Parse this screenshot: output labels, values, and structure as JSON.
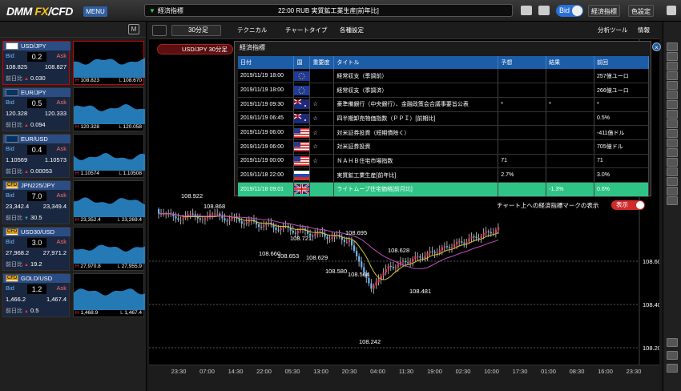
{
  "header": {
    "logo": "DMM FX/CFD",
    "menu_label": "MENU",
    "ticker_label": "経済指標",
    "ticker_message": "22:00 RUB 実質鉱工業生産[前年比]",
    "bid_toggle": "Bid",
    "eco_indicator_btn": "経済指標",
    "color_setting_btn": "色設定"
  },
  "rates": [
    {
      "name": "USD/JPY",
      "bid_label": "Bid",
      "ask_label": "Ask",
      "spread": "0.2",
      "bid": "108.825",
      "ask": "108.827",
      "prev_label": "前日比",
      "change": "0.030",
      "dir": "up",
      "high": "108.823",
      "low": "108.670"
    },
    {
      "name": "EUR/JPY",
      "bid_label": "Bid",
      "ask_label": "Ask",
      "spread": "0.5",
      "bid": "120.328",
      "ask": "120.333",
      "prev_label": "前日比",
      "change": "0.094",
      "dir": "up",
      "high": "120.328",
      "low": "120.058"
    },
    {
      "name": "EUR/USD",
      "bid_label": "Bid",
      "ask_label": "Ask",
      "spread": "0.4",
      "bid": "1.10569",
      "ask": "1.10573",
      "prev_label": "前日比",
      "change": "0.00053",
      "dir": "up",
      "high": "1.10574",
      "low": "1.10508"
    },
    {
      "name": "JPN225/JPY",
      "bid_label": "Bid",
      "ask_label": "Ask",
      "spread": "7.0",
      "bid": "23,342.4",
      "ask": "23,349.4",
      "prev_label": "前日比",
      "change": "30.5",
      "dir": "dn",
      "high": "23,352.4",
      "low": "23,269.4"
    },
    {
      "name": "USD30/USD",
      "bid_label": "Bid",
      "ask_label": "Ask",
      "spread": "3.0",
      "bid": "27,968.2",
      "ask": "27,971.2",
      "prev_label": "前日比",
      "change": "19.2",
      "dir": "up",
      "high": "27,970.8",
      "low": "27,955.9"
    },
    {
      "name": "GOLD/USD",
      "bid_label": "Bid",
      "ask_label": "Ask",
      "spread": "1.2",
      "bid": "1,466.2",
      "ask": "1,467.4",
      "prev_label": "前日比",
      "change": "0.5",
      "dir": "up",
      "high": "1,468.9",
      "low": "1,467.4"
    }
  ],
  "chart": {
    "period": "30分足",
    "technical_btn": "テクニカル",
    "chart_type_btn": "チャートタイプ",
    "settings_btn": "各種設定",
    "analysis_btn": "分析ツール",
    "info_btn": "情報",
    "tab_label": "USD/JPY 30分足",
    "y_labels": [
      "108.600",
      "108.400",
      "108.200"
    ],
    "time_labels": [
      "23:30",
      "07:00",
      "14:30",
      "22:00",
      "05:30",
      "13:00",
      "20:30",
      "04:00",
      "11:30",
      "19:00",
      "02:30",
      "10:00",
      "17:30",
      "01:00",
      "08:30",
      "16:00",
      "23:30"
    ],
    "price_labels": [
      "108.922",
      "108.868",
      "108.721",
      "108.695",
      "108.660",
      "108.653",
      "108.629",
      "108.628",
      "108.580",
      "108.564",
      "108.481",
      "108.242"
    ],
    "mark_toggle_label": "チャート上への経済指標マークの表示",
    "mark_btn": "表示"
  },
  "eco_panel": {
    "title": "経済指標",
    "headers": [
      "日付",
      "国",
      "重要度",
      "タイトル",
      "予想",
      "結果",
      "前回"
    ],
    "rows": [
      {
        "date": "2019/11/19 18:00",
        "flag": "eu",
        "importance": "",
        "title": "経常収支（季調前）",
        "forecast": "",
        "result": "",
        "previous": "257億ユーロ"
      },
      {
        "date": "2019/11/19 18:00",
        "flag": "eu",
        "importance": "",
        "title": "経常収支（季調済）",
        "forecast": "",
        "result": "",
        "previous": "266億ユーロ"
      },
      {
        "date": "2019/11/19 09:30",
        "flag": "au",
        "importance": "☆",
        "title": "豪準備銀行（中央銀行）、金融政策会合議事要旨公表",
        "forecast": "*",
        "result": "*",
        "previous": "*"
      },
      {
        "date": "2019/11/19 06:45",
        "flag": "au",
        "importance": "☆",
        "title": "四半期卸売物価指数（ＰＰＩ）[前期比]",
        "forecast": "",
        "result": "",
        "previous": "0.5%"
      },
      {
        "date": "2019/11/19 06:00",
        "flag": "us",
        "importance": "☆",
        "title": "対米証券投資（短期債除く）",
        "forecast": "",
        "result": "",
        "previous": "-411億ドル"
      },
      {
        "date": "2019/11/19 06:00",
        "flag": "us",
        "importance": "☆",
        "title": "対米証券投資",
        "forecast": "",
        "result": "",
        "previous": "705億ドル"
      },
      {
        "date": "2019/11/19 00:00",
        "flag": "us",
        "importance": "☆",
        "title": "ＮＡＨＢ住宅市場指数",
        "forecast": "71",
        "result": "",
        "previous": "71"
      },
      {
        "date": "2019/11/18 22:00",
        "flag": "ru",
        "importance": "",
        "title": "実質鉱工業生産[前年比]",
        "forecast": "2.7%",
        "result": "",
        "previous": "3.0%"
      },
      {
        "date": "2019/11/18 09:01",
        "flag": "uk",
        "importance": "",
        "title": "ライトムーブ住宅価格[前月比]",
        "forecast": "",
        "result": "-1.3%",
        "previous": "0.6%"
      }
    ]
  }
}
